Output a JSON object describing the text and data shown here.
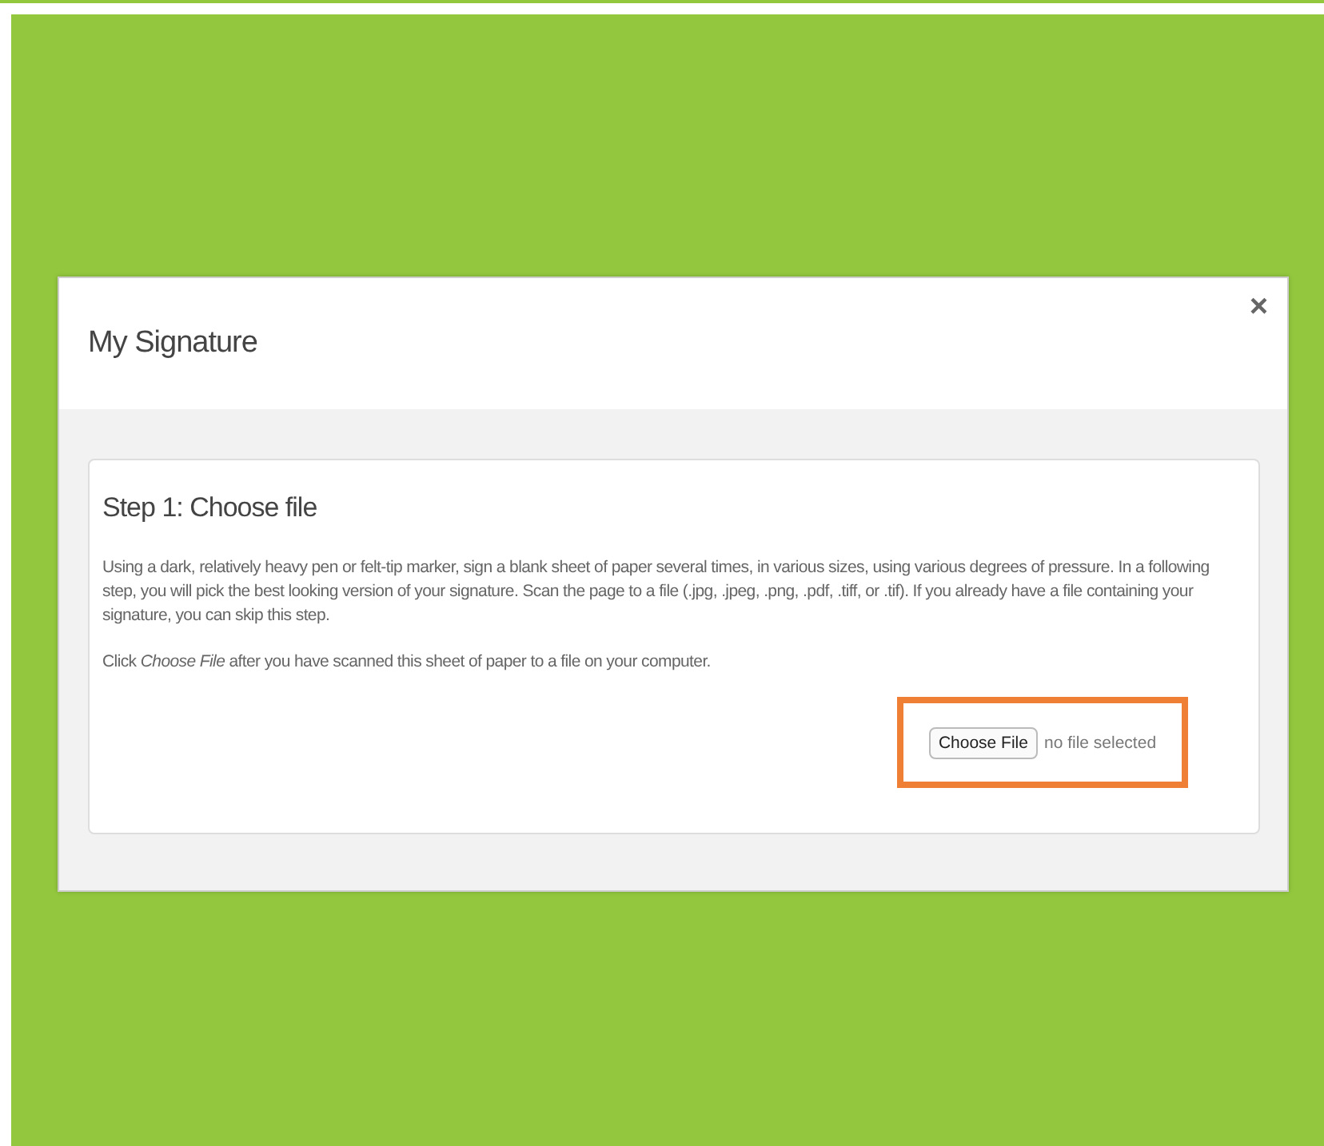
{
  "dialog": {
    "title": "My Signature",
    "close": "×"
  },
  "step": {
    "title": "Step 1: Choose file",
    "paragraphs": [
      "Using a dark, relatively heavy pen or felt-tip marker, sign a blank sheet of paper several times, in various sizes, using various degrees of pressure. In a following step, you will pick the best looking version of your signature. Scan the page to a file (.jpg, .jpeg, .png, .pdf, .tiff, or .tif). If you already have a file containing your signature, you can skip this step.",
      "Click *Choose File* after you have scanned this sheet of paper to a file on your computer."
    ],
    "file_input": {
      "button": "Choose File",
      "status": "no file selected",
      "highlighted": true
    }
  }
}
